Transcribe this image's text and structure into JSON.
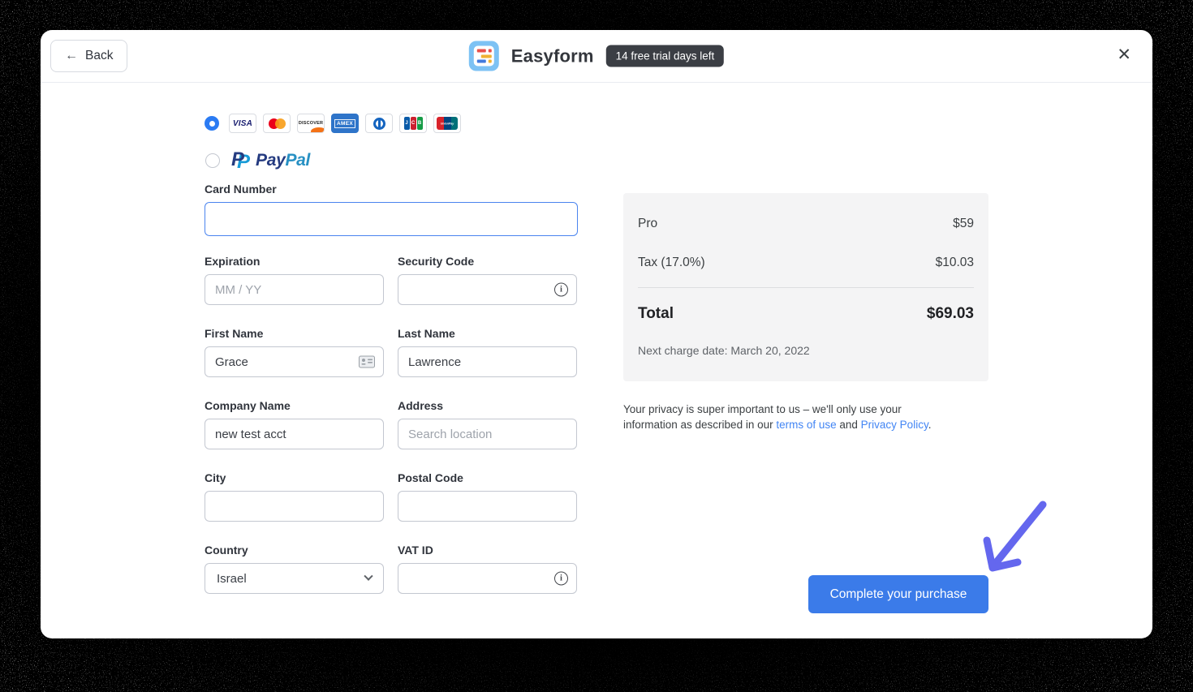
{
  "header": {
    "back_label": "Back",
    "back_arrow": "←",
    "app_name": "Easyform",
    "trial_badge": "14 free trial days left",
    "close_icon": "✕"
  },
  "payment": {
    "brands": [
      {
        "id": "visa",
        "label": "VISA"
      },
      {
        "id": "mastercard",
        "label": ""
      },
      {
        "id": "discover",
        "label": "DISCOVER"
      },
      {
        "id": "amex",
        "label": "AMEX"
      },
      {
        "id": "diners",
        "label": ""
      },
      {
        "id": "jcb",
        "letters": [
          "J",
          "C",
          "B"
        ]
      },
      {
        "id": "unionpay",
        "label": "UnionPay"
      }
    ],
    "paypal": {
      "mark1": "P",
      "mark2": "P",
      "word1": "Pay",
      "word2": "Pal"
    }
  },
  "form": {
    "card_number": {
      "label": "Card Number",
      "value": ""
    },
    "expiration": {
      "label": "Expiration",
      "placeholder": "MM / YY",
      "value": ""
    },
    "security_code": {
      "label": "Security Code",
      "value": ""
    },
    "first_name": {
      "label": "First Name",
      "value": "Grace"
    },
    "last_name": {
      "label": "Last Name",
      "value": "Lawrence"
    },
    "company_name": {
      "label": "Company Name",
      "value": "new test acct"
    },
    "address": {
      "label": "Address",
      "placeholder": "Search location",
      "value": ""
    },
    "city": {
      "label": "City",
      "value": ""
    },
    "postal_code": {
      "label": "Postal Code",
      "value": ""
    },
    "country": {
      "label": "Country",
      "value": "Israel"
    },
    "vat_id": {
      "label": "VAT ID",
      "value": ""
    },
    "info_glyph": "i"
  },
  "summary": {
    "items": [
      {
        "label": "Pro",
        "amount": "$59"
      },
      {
        "label": "Tax (17.0%)",
        "amount": "$10.03"
      }
    ],
    "total_label": "Total",
    "total_amount": "$69.03",
    "next_charge": "Next charge date: March 20, 2022"
  },
  "privacy": {
    "before": "Your privacy is super important to us – we'll only use your information as described in our ",
    "terms": "terms of use",
    "middle": " and ",
    "policy": "Privacy Policy",
    "after": "."
  },
  "cta": {
    "label": "Complete your purchase"
  },
  "colors": {
    "accent": "#3b7be9",
    "link": "#4285f4",
    "arrow": "#6467ee",
    "badge_bg": "#3b3e44",
    "summary_bg": "#f4f4f5",
    "focus_border": "#4a84ef"
  }
}
